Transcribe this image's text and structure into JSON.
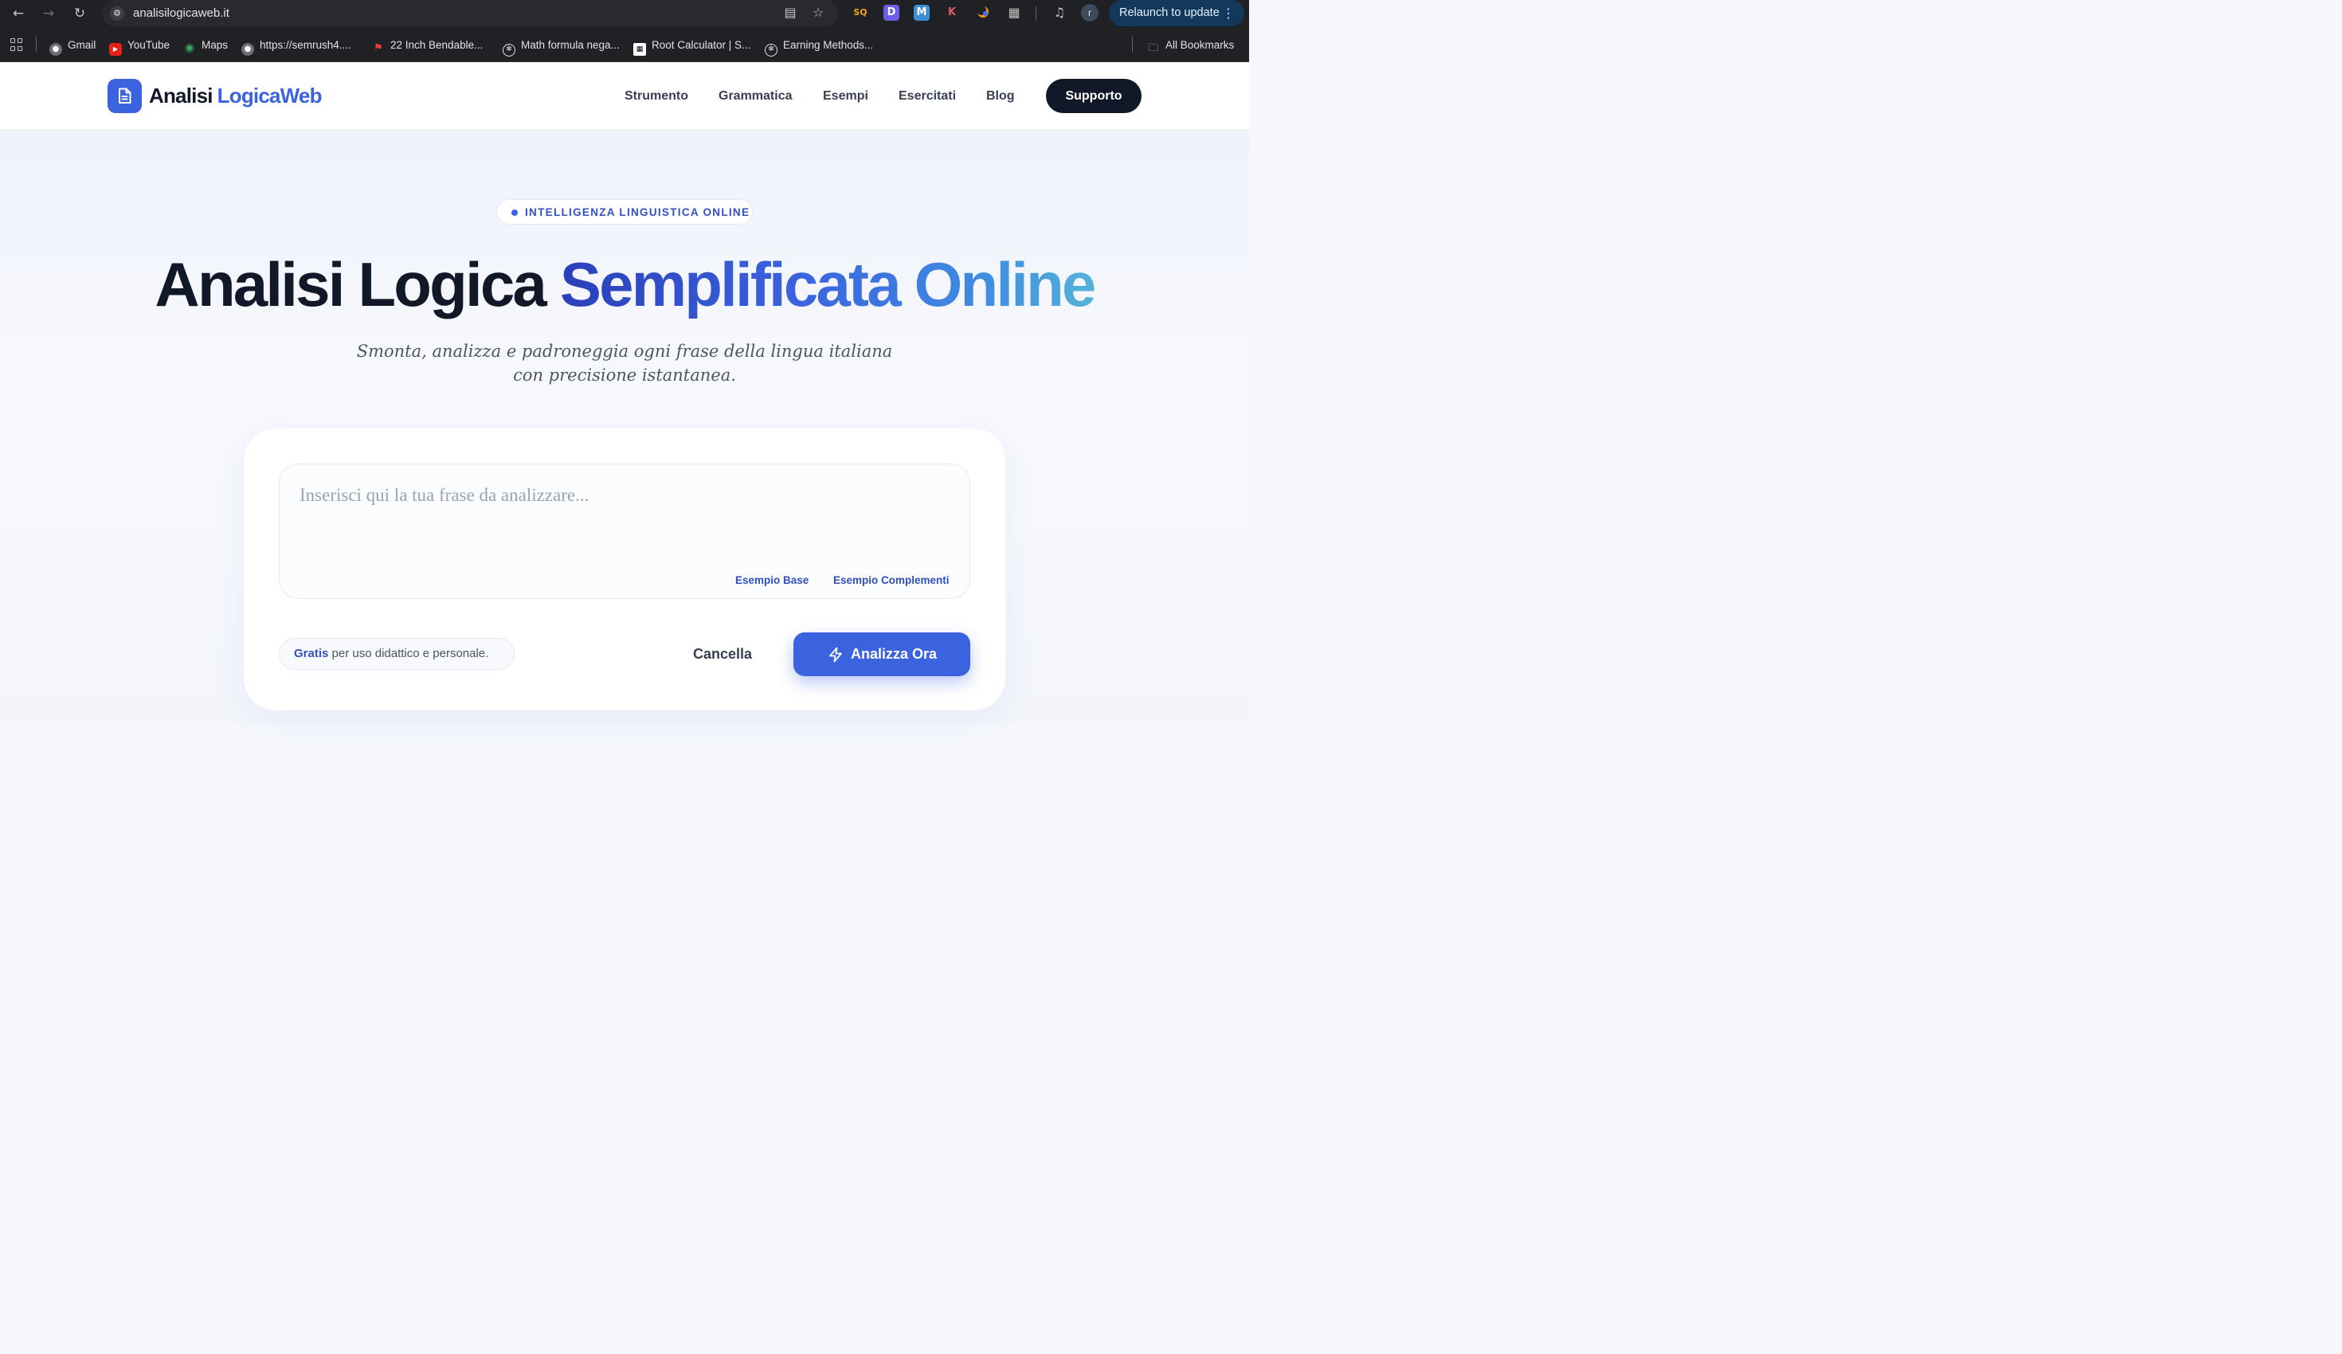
{
  "browser": {
    "url": "analisilogicaweb.it",
    "relaunch_label": "Relaunch to update",
    "profile_initial": "r",
    "extensions": [
      "SQ",
      "D",
      "M",
      "K"
    ],
    "bookmarks": [
      {
        "label": "Gmail"
      },
      {
        "label": "YouTube"
      },
      {
        "label": "Maps"
      },
      {
        "label": "https://semrush4...."
      },
      {
        "label": "22 Inch Bendable..."
      },
      {
        "label": "Math formula nega..."
      },
      {
        "label": "Root Calculator | S..."
      },
      {
        "label": "Earning Methods..."
      }
    ],
    "all_bookmarks_label": "All Bookmarks"
  },
  "site": {
    "brand_part1": "Analisi",
    "brand_part2": "LogicaWeb",
    "nav": [
      {
        "label": "Strumento"
      },
      {
        "label": "Grammatica"
      },
      {
        "label": "Esempi"
      },
      {
        "label": "Esercitati"
      },
      {
        "label": "Blog"
      }
    ],
    "support_label": "Supporto"
  },
  "hero": {
    "pill_label": "INTELLIGENZA LINGUISTICA ONLINE",
    "title_dark": "Analisi Logica",
    "title_gradient": "Semplificata Online",
    "subtitle": "Smonta, analizza e padroneggia ogni frase della lingua italiana con precisione istantanea."
  },
  "tool": {
    "input_placeholder": "Inserisci qui la tua frase da analizzare...",
    "input_value": "",
    "example_base_label": "Esempio Base",
    "example_complements_label": "Esempio Complementi",
    "free_strong": "Gratis",
    "free_rest": " per uso didattico e personale.",
    "cancel_label": "Cancella",
    "analyze_label": "Analizza Ora"
  },
  "colors": {
    "accent": "#3b63e0",
    "dark": "#111827",
    "relaunch_bg": "#12395b"
  }
}
